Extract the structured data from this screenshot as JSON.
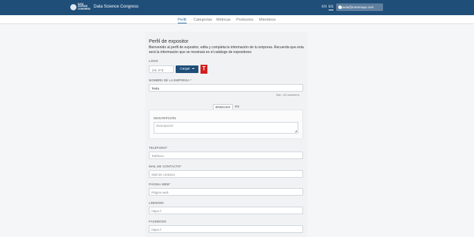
{
  "header": {
    "brand_logo_text": "DATA SCIENCE CONGRESS",
    "title": "Data Science Congress",
    "lang_en": "EN",
    "lang_es": "ES",
    "user_email": "paola@meetmaps.com"
  },
  "nav": {
    "items": [
      "Perfil",
      "Categorías",
      "Métricas",
      "Productos",
      "Miembros"
    ]
  },
  "form": {
    "title": "Perfil de expositor",
    "intro": "Bienvenido al perfil de expositor, edita y completa la información de tu empresa. Recuerda que esta será la información que se mostrará en el catálogo de expositores",
    "logo_label": "LOGO",
    "logo_placeholder": ".jpg .png",
    "upload_label": "Cargar",
    "logo_letter": "T",
    "company_label": "NOMBRE DE LA EMPRESA *",
    "company_value": "Tesla",
    "max_chars": "Máx. 120 caracteres",
    "tab_english": "ENGLISH",
    "tab_es": "ES",
    "description_label": "DESCRIPCIÓN",
    "description_placeholder": "Descripción",
    "phone_label": "TELÉFONO*",
    "phone_placeholder": "Teléfono",
    "email_label": "MAIL DE CONTACTO*",
    "email_placeholder": "Mail de contacto",
    "web_label": "PÁGINA WEB*",
    "web_placeholder": "Página web",
    "linkedin_label": "LINKEDIN",
    "linkedin_placeholder": "https://",
    "facebook_label": "FACEBOOK",
    "facebook_placeholder": "https://"
  },
  "colors": {
    "header_bg": "#1f4e79",
    "accent": "#2f6ea6",
    "logo_red": "#d2201f"
  }
}
